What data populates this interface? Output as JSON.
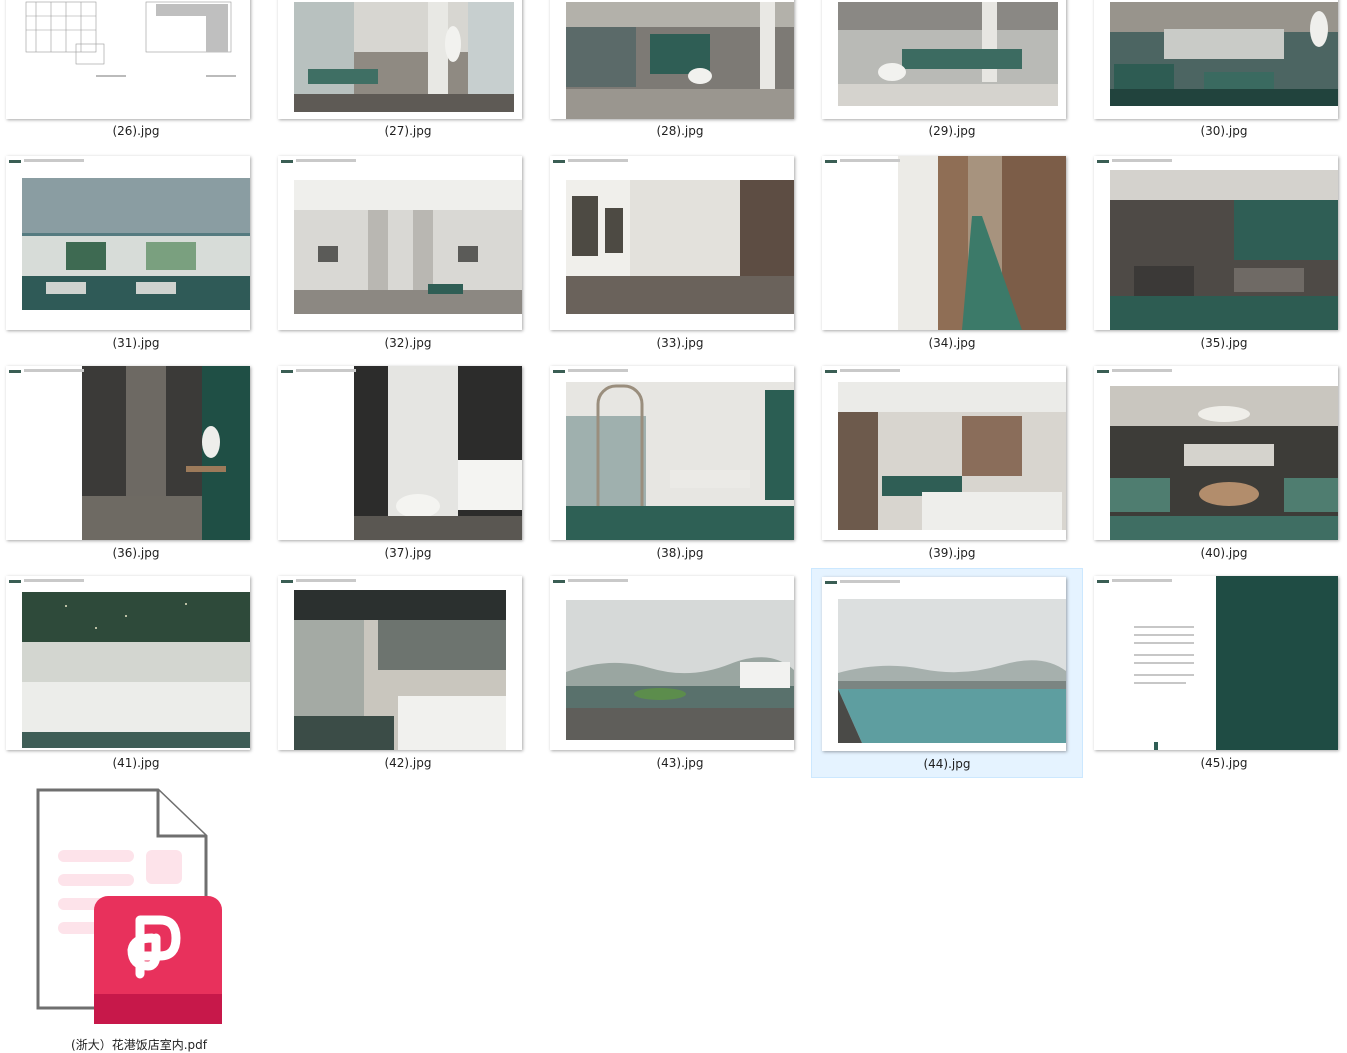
{
  "files": [
    {
      "label": "(26).jpg"
    },
    {
      "label": "(27).jpg"
    },
    {
      "label": "(28).jpg"
    },
    {
      "label": "(29).jpg"
    },
    {
      "label": "(30).jpg"
    },
    {
      "label": "(31).jpg"
    },
    {
      "label": "(32).jpg"
    },
    {
      "label": "(33).jpg"
    },
    {
      "label": "(34).jpg"
    },
    {
      "label": "(35).jpg"
    },
    {
      "label": "(36).jpg"
    },
    {
      "label": "(37).jpg"
    },
    {
      "label": "(38).jpg"
    },
    {
      "label": "(39).jpg"
    },
    {
      "label": "(40).jpg"
    },
    {
      "label": "(41).jpg"
    },
    {
      "label": "(42).jpg"
    },
    {
      "label": "(43).jpg"
    },
    {
      "label": "(44).jpg"
    },
    {
      "label": "(45).jpg"
    }
  ],
  "selected_file": "(44).jpg",
  "pdf_file": {
    "label": "(浙大）花港饭店室内.pdf",
    "icon": "pdf-document-icon"
  },
  "colors": {
    "selection_bg": "#e5f3ff",
    "selection_border": "#cce8ff",
    "pdf_badge": "#e8315c",
    "accent_green": "#2f5e55"
  }
}
